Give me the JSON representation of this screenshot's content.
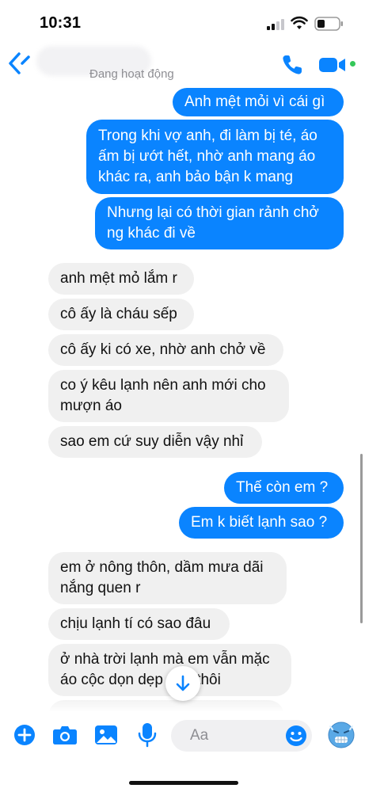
{
  "status_bar": {
    "time": "10:31"
  },
  "header": {
    "status": "Đang hoạt động",
    "icons": [
      "back-icon",
      "phone-icon",
      "video-icon"
    ],
    "online_color": "#34c759"
  },
  "colors": {
    "accent": "#0a84ff",
    "incoming_bubble": "#f0f0f0"
  },
  "messages": [
    {
      "side": "out",
      "text": [
        "Anh mệt mỏi vì cái gì"
      ]
    },
    {
      "side": "out",
      "text": [
        "Trong khi vợ anh, đi làm bị té, áo",
        "ấm bị ướt hết, nhờ anh mang áo",
        "khác ra, anh bảo bận k mang"
      ]
    },
    {
      "side": "out",
      "text": [
        "Nhưng lại có thời gian rảnh chở",
        "ng khác đi về"
      ]
    },
    {
      "side": "in",
      "text": [
        "anh mệt mỏ lắm r"
      ]
    },
    {
      "side": "in",
      "text": [
        "cô ấy là cháu sếp"
      ]
    },
    {
      "side": "in",
      "text": [
        "cô ấy ki có xe, nhờ anh chở về"
      ]
    },
    {
      "side": "in",
      "text": [
        "co ý kêu lạnh nên anh mới cho",
        "mượn áo"
      ]
    },
    {
      "side": "in",
      "text": [
        "sao em cứ suy diễn vậy nhỉ"
      ]
    },
    {
      "side": "out",
      "text": [
        "Thế còn em ?"
      ]
    },
    {
      "side": "out",
      "text": [
        "Em k biết lạnh sao ?"
      ]
    },
    {
      "side": "in",
      "text": [
        "em ở nông thôn, dầm mưa dãi",
        "nắng quen r"
      ]
    },
    {
      "side": "in",
      "text": [
        "chịu lạnh tí có sao đâu"
      ]
    },
    {
      "side": "in",
      "text": [
        "ở nhà trời lạnh mà em vẫn mặc",
        "áo cộc dọn dẹp nhà thôi"
      ]
    }
  ],
  "composer": {
    "placeholder": "Aa",
    "icons": [
      "plus-icon",
      "camera-icon",
      "image-icon",
      "microphone-icon",
      "emoji-icon",
      "cold-face-emoji-icon"
    ]
  }
}
